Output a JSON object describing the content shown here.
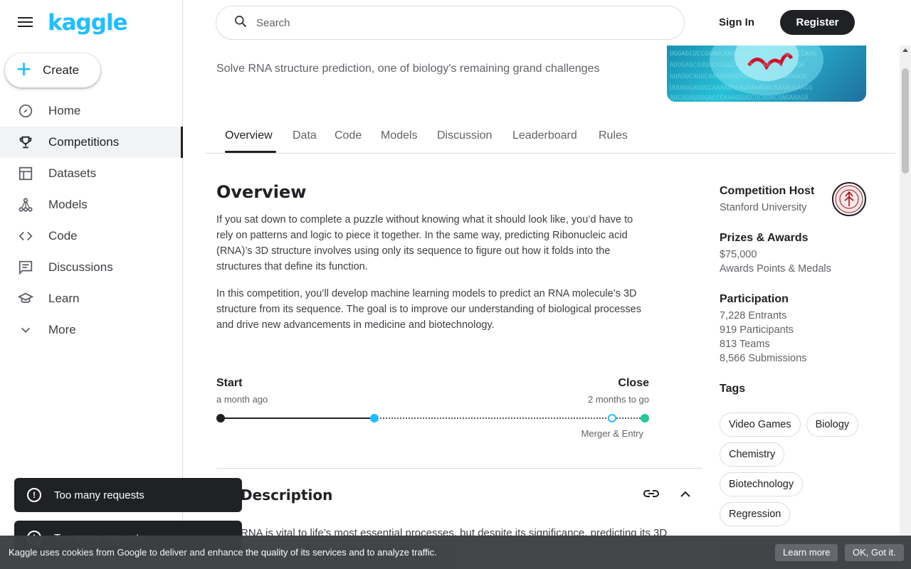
{
  "sidebar": {
    "logo": "kaggle",
    "create_label": "Create",
    "items": [
      {
        "label": "Home",
        "icon": "compass-icon"
      },
      {
        "label": "Competitions",
        "icon": "trophy-icon",
        "active": true
      },
      {
        "label": "Datasets",
        "icon": "table-icon"
      },
      {
        "label": "Models",
        "icon": "models-icon"
      },
      {
        "label": "Code",
        "icon": "code-icon"
      },
      {
        "label": "Discussions",
        "icon": "chat-icon"
      },
      {
        "label": "Learn",
        "icon": "school-icon"
      },
      {
        "label": "More",
        "icon": "chevron-down-icon"
      }
    ]
  },
  "header": {
    "search_placeholder": "Search",
    "signin_label": "Sign In",
    "register_label": "Register"
  },
  "competition": {
    "subtitle": "Solve RNA structure prediction, one of biology's remaining grand challenges"
  },
  "tabs": [
    "Overview",
    "Data",
    "Code",
    "Models",
    "Discussion",
    "Leaderboard",
    "Rules"
  ],
  "overview": {
    "heading": "Overview",
    "paragraph1": "If you sat down to complete a puzzle without knowing what it should look like, you’d have to rely on patterns and logic to piece it together. In the same way, predicting Ribonucleic acid (RNA)’s 3D structure involves using only its sequence to figure out how it folds into the structures that define its function.",
    "paragraph2": "In this competition, you’ll develop machine learning models to predict an RNA molecule’s 3D structure from its sequence. The goal is to improve our understanding of biological processes and drive new advancements in medicine and biotechnology."
  },
  "timeline": {
    "start_label": "Start",
    "start_sub": "a month ago",
    "close_label": "Close",
    "close_sub": "2 months to go",
    "merger_label": "Merger & Entry"
  },
  "description": {
    "title": "Description",
    "snippet": "RNA is vital to life’s most essential processes, but despite its significance, predicting its 3D"
  },
  "aside": {
    "host_heading": "Competition Host",
    "host_name": "Stanford University",
    "prizes_heading": "Prizes & Awards",
    "prize_amount": "$75,000",
    "prize_extra": "Awards Points & Medals",
    "participation_heading": "Participation",
    "entrants": "7,228 Entrants",
    "participants": "919 Participants",
    "teams": "813 Teams",
    "submissions": "8,566 Submissions",
    "tags_heading": "Tags",
    "tags": [
      "Video Games",
      "Biology",
      "Chemistry",
      "Biotechnology",
      "Regression"
    ]
  },
  "toasts": [
    "Too many requests",
    "Too many requests"
  ],
  "cookie": {
    "text": "Kaggle uses cookies from Google to deliver and enhance the quality of its services and to analyze traffic.",
    "learn_more": "Learn more",
    "ok": "OK, Got it."
  },
  "colors": {
    "accent": "#20beff",
    "dark": "#202124",
    "timeline_end": "#20c997"
  }
}
